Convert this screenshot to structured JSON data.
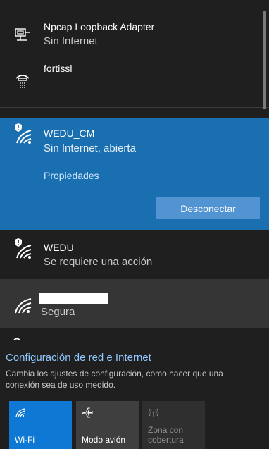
{
  "networks": [
    {
      "title": "Npcap Loopback Adapter",
      "status": "Sin Internet",
      "icon": "ethernet-adapter-icon"
    },
    {
      "title": "fortissl",
      "status": "",
      "icon": "dialup-vpn-icon"
    },
    {
      "title": "WEDU_CM",
      "status": "Sin Internet, abierta",
      "icon": "wifi-shield-icon",
      "properties_link": "Propiedades",
      "disconnect_label": "Desconectar"
    },
    {
      "title": "WEDU",
      "status": "Se requiere una acción",
      "icon": "wifi-shield-icon"
    },
    {
      "title": "",
      "status": "Segura",
      "icon": "wifi-icon"
    }
  ],
  "settings": {
    "title": "Configuración de red e Internet",
    "description": "Cambia los ajustes de configuración, como hacer que una conexión sea de uso medido."
  },
  "quick_actions": [
    {
      "label": "Wi-Fi",
      "state": "on",
      "icon": "wifi-icon"
    },
    {
      "label": "Modo avión",
      "state": "off",
      "icon": "airplane-icon"
    },
    {
      "label": "Zona con\ncobertura",
      "state": "disabled",
      "icon": "hotspot-icon"
    }
  ],
  "colors": {
    "background": "#1f1f1f",
    "selected": "#1a6fb1",
    "button": "#5294d1",
    "accent_link": "#8fc7ff",
    "tile_active": "#0f78d4"
  }
}
